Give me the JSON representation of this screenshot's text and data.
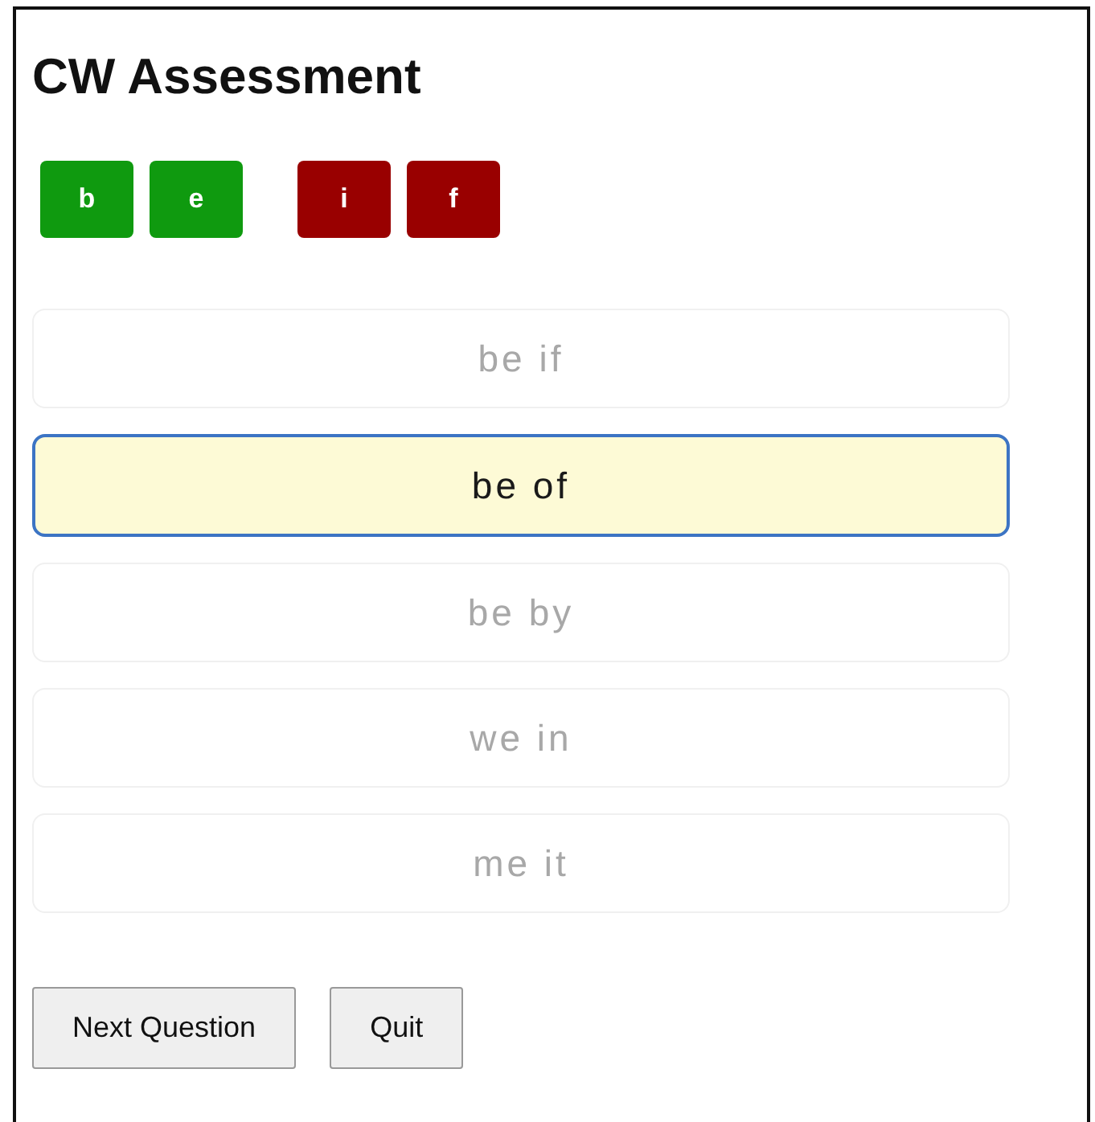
{
  "title": "CW Assessment",
  "letter_groups": [
    {
      "letters": [
        {
          "label": "b",
          "color": "#0f9a0f"
        },
        {
          "label": "e",
          "color": "#0f9a0f"
        }
      ]
    },
    {
      "letters": [
        {
          "label": "i",
          "color": "#990000"
        },
        {
          "label": "f",
          "color": "#990000"
        }
      ]
    }
  ],
  "options": [
    {
      "label": "be if",
      "selected": false
    },
    {
      "label": "be of",
      "selected": true
    },
    {
      "label": "be by",
      "selected": false
    },
    {
      "label": "we in",
      "selected": false
    },
    {
      "label": "me it",
      "selected": false
    }
  ],
  "buttons": [
    "Next Question",
    "Quit"
  ]
}
